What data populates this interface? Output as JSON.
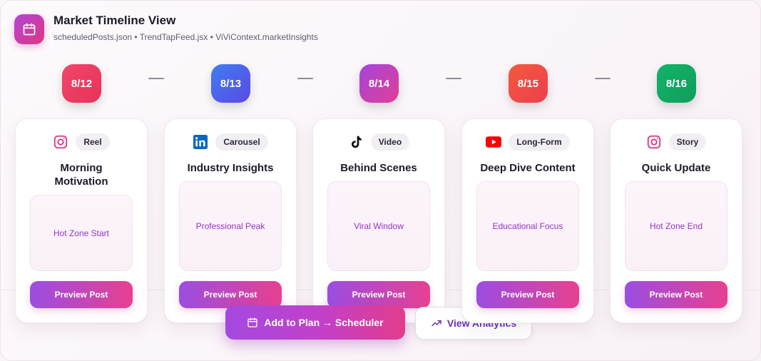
{
  "header": {
    "icon": "calendar-icon",
    "title": "Market Timeline View",
    "subtitle": "scheduledPosts.json • TrendTapFeed.jsx • ViViContext.marketInsights"
  },
  "dates": [
    {
      "label": "8/12",
      "color_from": "#f0466a",
      "color_to": "#e8325a"
    },
    {
      "label": "8/13",
      "color_from": "#3f7df2",
      "color_to": "#5b49e3"
    },
    {
      "label": "8/14",
      "color_from": "#a246dc",
      "color_to": "#e23e95"
    },
    {
      "label": "8/15",
      "color_from": "#f25a3c",
      "color_to": "#ee3e4e"
    },
    {
      "label": "8/16",
      "color_from": "#13b36a",
      "color_to": "#0f9e5c"
    }
  ],
  "cards": [
    {
      "platform": "instagram-icon",
      "format": "Reel",
      "title": "Morning Motivation",
      "zone": "Hot Zone Start",
      "button": "Preview Post"
    },
    {
      "platform": "linkedin-icon",
      "format": "Carousel",
      "title": "Industry Insights",
      "zone": "Professional Peak",
      "button": "Preview Post"
    },
    {
      "platform": "tiktok-icon",
      "format": "Video",
      "title": "Behind Scenes",
      "zone": "Viral Window",
      "button": "Preview Post"
    },
    {
      "platform": "youtube-icon",
      "format": "Long-Form",
      "title": "Deep Dive Content",
      "zone": "Educational Focus",
      "button": "Preview Post"
    },
    {
      "platform": "instagram-icon",
      "format": "Story",
      "title": "Quick Update",
      "zone": "Hot Zone End",
      "button": "Preview Post"
    }
  ],
  "actions": {
    "add_label": "Add to Plan → Scheduler",
    "analytics_label": "View Analytics"
  },
  "colors": {
    "accent_purple": "#9b4de3",
    "accent_pink": "#e8408f",
    "zone_text": "#9333c9"
  }
}
